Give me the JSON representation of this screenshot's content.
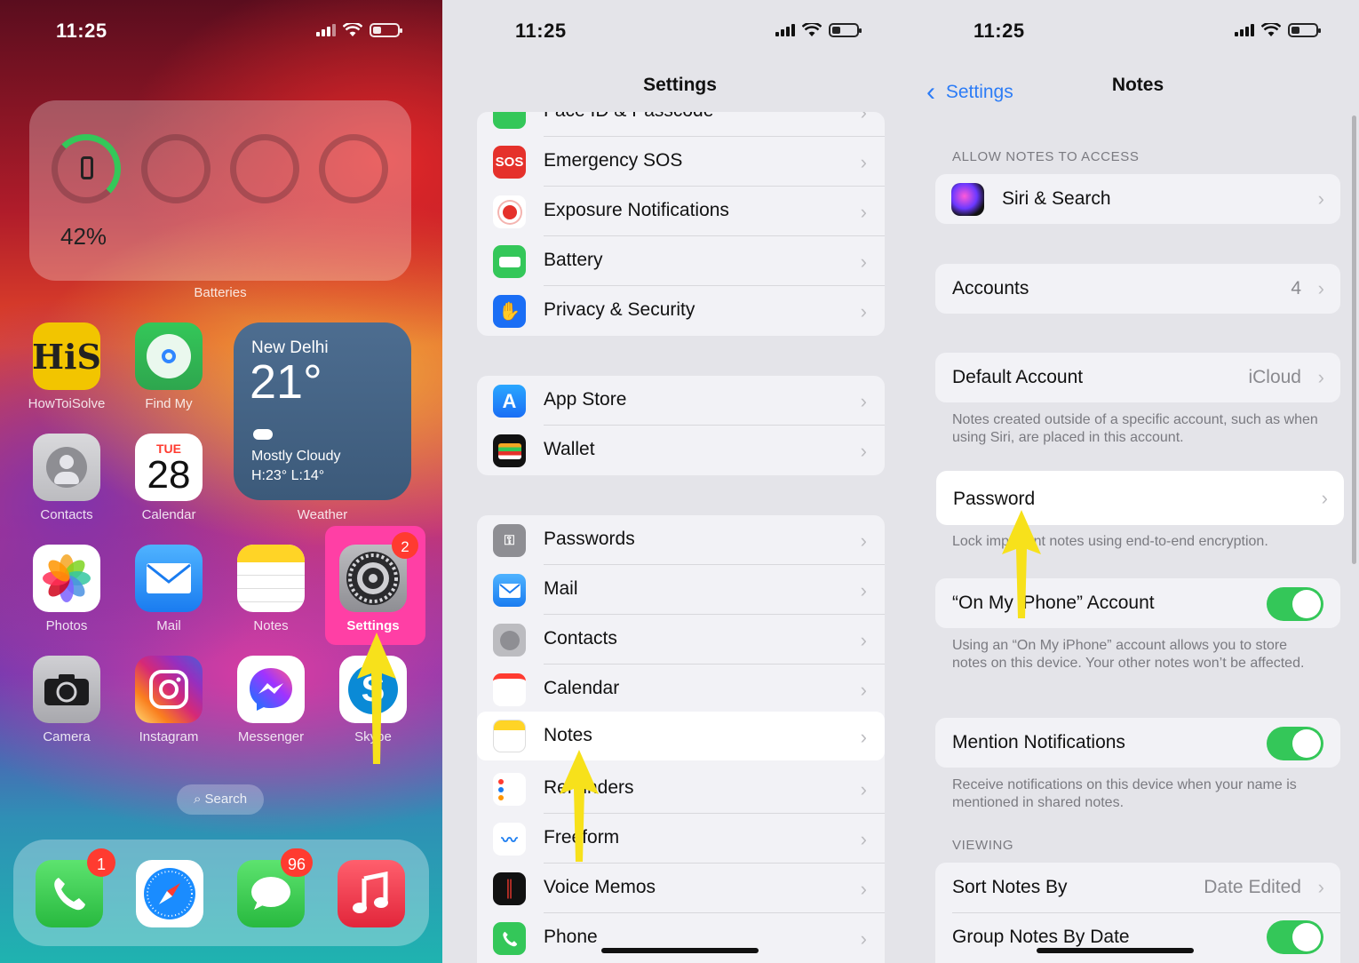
{
  "status": {
    "time": "11:25"
  },
  "home": {
    "battery_widget": {
      "percent": "42%",
      "label": "Batteries",
      "level": 0.42
    },
    "weather": {
      "city": "New Delhi",
      "temp": "21°",
      "condition": "Mostly Cloudy",
      "hilo": "H:23° L:14°",
      "label": "Weather"
    },
    "calendar": {
      "weekday": "TUE",
      "day": "28"
    },
    "apps": {
      "howtoisolve": "HowToiSolve",
      "findmy": "Find My",
      "contacts": "Contacts",
      "calendar": "Calendar",
      "photos": "Photos",
      "mail": "Mail",
      "notes": "Notes",
      "settings": "Settings",
      "camera": "Camera",
      "instagram": "Instagram",
      "messenger": "Messenger",
      "skype": "Skype"
    },
    "settings_badge": "2",
    "search": "Search",
    "dock_badges": {
      "phone": "1",
      "messages": "96"
    },
    "howtoisolve_logo": "HiS"
  },
  "settings": {
    "title": "Settings",
    "group1": [
      "Face ID & Passcode",
      "Emergency SOS",
      "Exposure Notifications",
      "Battery",
      "Privacy & Security"
    ],
    "group2": [
      "App Store",
      "Wallet"
    ],
    "group3": [
      "Passwords",
      "Mail",
      "Contacts",
      "Calendar",
      "Notes",
      "Reminders",
      "Freeform",
      "Voice Memos",
      "Phone"
    ],
    "sos_icon_text": "SOS"
  },
  "notes_settings": {
    "back": "Settings",
    "title": "Notes",
    "allow_header": "ALLOW NOTES TO ACCESS",
    "siri": "Siri & Search",
    "accounts": {
      "label": "Accounts",
      "value": "4"
    },
    "default_account": {
      "label": "Default Account",
      "value": "iCloud"
    },
    "default_footer": "Notes created outside of a specific account, such as when using Siri, are placed in this account.",
    "password": "Password",
    "password_footer": "Lock important notes using end-to-end encryption.",
    "on_my_phone": "“On My iPhone” Account",
    "on_my_phone_footer": "Using an “On My iPhone” account allows you to store notes on this device. Your other notes won’t be affected.",
    "mention": "Mention Notifications",
    "mention_footer": "Receive notifications on this device when your name is mentioned in shared notes.",
    "viewing_header": "VIEWING",
    "sort": {
      "label": "Sort Notes By",
      "value": "Date Edited"
    },
    "group_by_date": "Group Notes By Date"
  },
  "colors": {
    "accent": "#2c7cf6",
    "toggle_on": "#34c759",
    "arrow": "#f7e11b",
    "badge": "#ff3b30"
  }
}
